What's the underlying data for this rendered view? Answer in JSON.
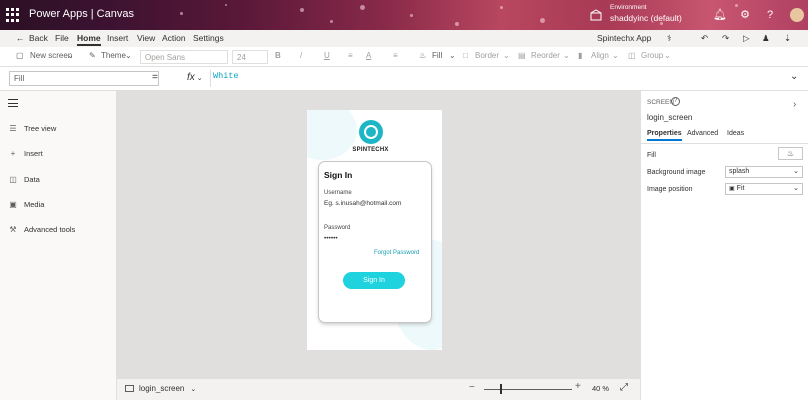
{
  "header": {
    "app_title": "Power Apps  |  Canvas",
    "env_label": "Environment",
    "env_name": "shaddyinc (default)"
  },
  "cmdbar": {
    "back": "Back",
    "file": "File",
    "home": "Home",
    "insert": "Insert",
    "view": "View",
    "action": "Action",
    "settings": "Settings",
    "app_name": "Spintechx App"
  },
  "ribbon": {
    "new_screen": "New screen",
    "theme": "Theme",
    "font": "Open Sans",
    "font_size": "24",
    "bold": "B",
    "italic": "/",
    "underline": "U",
    "font_color": "A",
    "fill": "Fill",
    "border": "Border",
    "reorder": "Reorder",
    "align": "Align",
    "group": "Group"
  },
  "formula_bar": {
    "property": "Fill",
    "equals": "=",
    "fx": "fx",
    "formula": "White"
  },
  "left_nav": {
    "items": [
      {
        "label": "Tree view"
      },
      {
        "label": "Insert"
      },
      {
        "label": "Data"
      },
      {
        "label": "Media"
      },
      {
        "label": "Advanced tools"
      }
    ]
  },
  "phone": {
    "brand": "SPINTECHX",
    "signin_title": "Sign In",
    "username_label": "Username",
    "username_value": "Eg. s.inusah@hotmail.com",
    "password_label": "Password",
    "password_value": "••••••",
    "forgot": "Forgot Password",
    "signin_button": "Sign In"
  },
  "bottom": {
    "screen_name": "login_screen",
    "zoom_minus": "−",
    "zoom_plus": "+",
    "zoom_value": "40  %",
    "zoom_level": 40
  },
  "properties": {
    "type_label": "SCREEN",
    "screen_name": "login_screen",
    "tabs": [
      "Properties",
      "Advanced",
      "Ideas"
    ],
    "fill_label": "Fill",
    "bg_image_label": "Background image",
    "bg_image_value": "splash",
    "image_position_label": "Image position",
    "image_position_value": "Fit"
  },
  "colors": {
    "accent_teal": "#1ed3de",
    "logo_teal": "#1db6c7",
    "formula_text": "#0aa2c0",
    "tab_underline": "#0078d4"
  }
}
